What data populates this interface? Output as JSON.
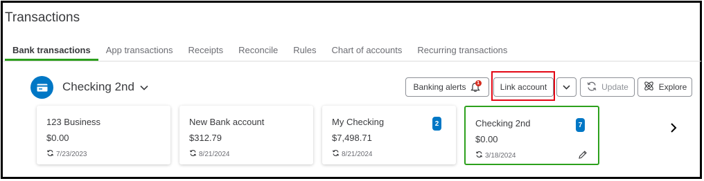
{
  "page": {
    "title": "Transactions"
  },
  "tabs": [
    {
      "label": "Bank transactions",
      "active": true
    },
    {
      "label": "App transactions"
    },
    {
      "label": "Receipts"
    },
    {
      "label": "Reconcile"
    },
    {
      "label": "Rules"
    },
    {
      "label": "Chart of accounts"
    },
    {
      "label": "Recurring transactions"
    }
  ],
  "account_selector": {
    "name": "Checking 2nd",
    "icon": "bank-card-icon"
  },
  "actions": {
    "banking_alerts": {
      "label": "Banking alerts",
      "icon": "bell-icon",
      "alert_count": "1"
    },
    "link_account": {
      "label": "Link account"
    },
    "update": {
      "label": "Update",
      "icon": "refresh-icon"
    },
    "explore": {
      "label": "Explore",
      "icon": "atom-icon"
    }
  },
  "cards": [
    {
      "name": "123 Business",
      "balance": "$0.00",
      "date": "7/23/2023",
      "badge": null
    },
    {
      "name": "New Bank account",
      "balance": "$312.79",
      "date": "8/21/2024",
      "badge": null
    },
    {
      "name": "My Checking",
      "balance": "$7,498.71",
      "date": "8/21/2024",
      "badge": "2"
    },
    {
      "name": "Checking 2nd",
      "balance": "$0.00",
      "date": "3/18/2024",
      "badge": "7",
      "selected": true
    }
  ],
  "colors": {
    "accent_green": "#2ca01c",
    "badge_blue": "#0077c5",
    "alert_red": "#d52b1e",
    "highlight_red": "#e30613"
  }
}
